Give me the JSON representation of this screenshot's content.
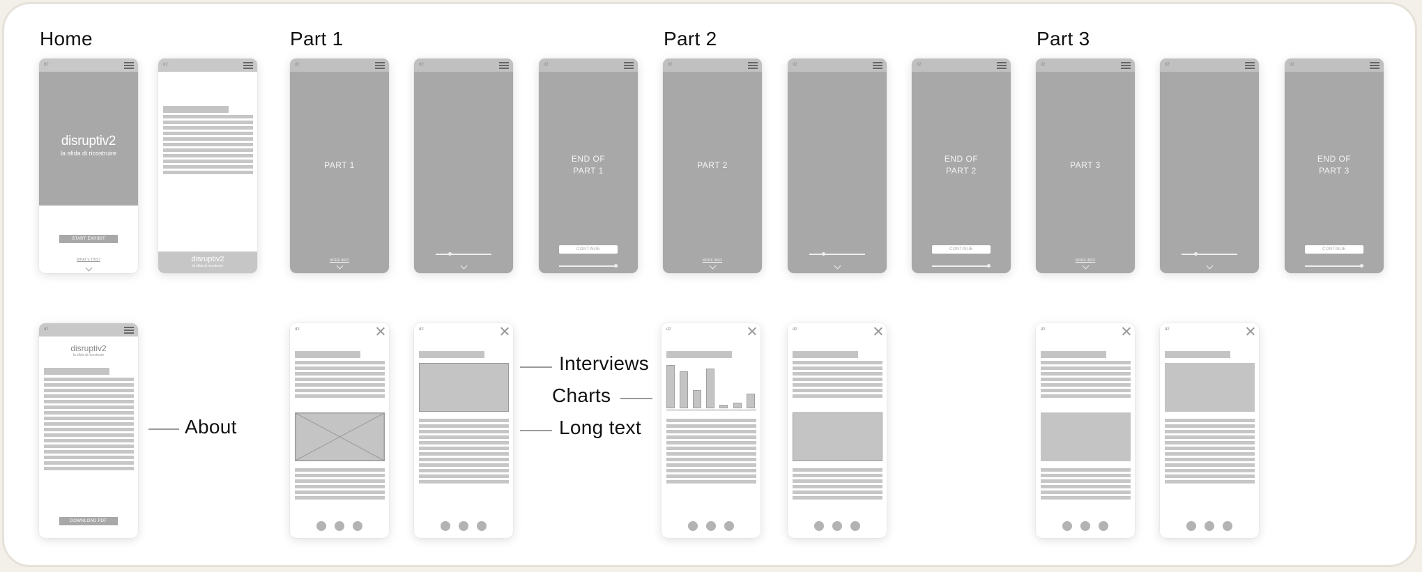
{
  "sections": {
    "home": "Home",
    "part1": "Part 1",
    "part2": "Part 2",
    "part3": "Part 3"
  },
  "brand": {
    "logo": "disruptiv2",
    "tagline": "la sfida di ricostruire",
    "mini_mark": "d2"
  },
  "home": {
    "start_button": "START EXHIBIT",
    "whats_this": "WHAT'S THIS?",
    "download_button": "DOWNLOAD PDF"
  },
  "screens": {
    "part1_title": "PART 1",
    "part2_title": "PART 2",
    "part3_title": "PART 3",
    "end1_line1": "END OF",
    "end1_line2": "PART 1",
    "end2_line1": "END OF",
    "end2_line2": "PART 2",
    "end3_line1": "END OF",
    "end3_line2": "PART 3",
    "more_info": "MORE INFO",
    "continue": "CONTINUE"
  },
  "callouts": {
    "about": "About",
    "interviews": "Interviews",
    "charts": "Charts",
    "long_text": "Long text"
  },
  "colors": {
    "screen_gray": "#a8a8a8",
    "placeholder": "#c6c6c6",
    "board_border": "#e6e1d9"
  }
}
